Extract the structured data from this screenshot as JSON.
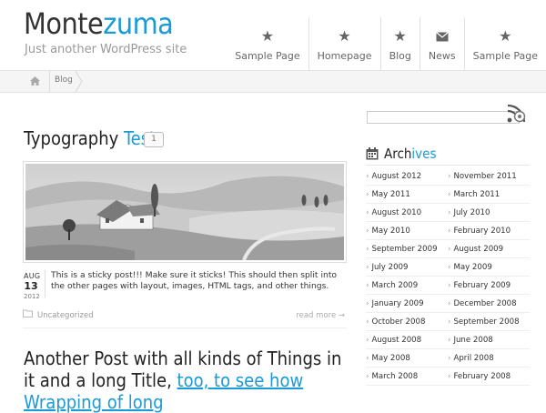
{
  "site": {
    "title_part1": "Monte",
    "title_part2": "zuma",
    "tagline": "Just another WordPress site"
  },
  "nav": {
    "items": [
      {
        "label": "Sample Page",
        "icon": "star-icon"
      },
      {
        "label": "Homepage",
        "icon": "star-icon",
        "active": true
      },
      {
        "label": "Blog",
        "icon": "star-icon"
      },
      {
        "label": "News",
        "icon": "envelope-icon"
      },
      {
        "label": "Sample Page",
        "icon": "star-icon"
      }
    ]
  },
  "breadcrumb": {
    "home_icon": "home-icon",
    "current": "Blog"
  },
  "post": {
    "title_part1": "Typography ",
    "title_part2": "Test",
    "comment_count": "1",
    "date_month": "AUG",
    "date_day": "13",
    "date_year": "2012",
    "excerpt": "This is a sticky post!!! Make sure it sticks! This should then split into the other pages with layout, images, HTML tags, and other things.",
    "category": "Uncategorized",
    "read_more": "read more →"
  },
  "post2": {
    "title_part1": "Another Post with all kinds of Things in it and a long Title, ",
    "title_part2": "too, to see how Wrapping of long"
  },
  "sidebar": {
    "search_placeholder": "",
    "archives_title_part1": "Arch",
    "archives_title_part2": "ives",
    "archives": [
      [
        "August 2012",
        "November 2011"
      ],
      [
        "May 2011",
        "March 2011"
      ],
      [
        "August 2010",
        "July 2010"
      ],
      [
        "May 2010",
        "February 2010"
      ],
      [
        "September 2009",
        "August 2009"
      ],
      [
        "July 2009",
        "May 2009"
      ],
      [
        "March 2009",
        "February 2009"
      ],
      [
        "January 2009",
        "December 2008"
      ],
      [
        "October 2008",
        "September 2008"
      ],
      [
        "August 2008",
        "June 2008"
      ],
      [
        "May 2008",
        "April 2008"
      ],
      [
        "March 2008",
        "February 2008"
      ]
    ]
  },
  "colors": {
    "accent": "#1a9ad6",
    "text": "#333333",
    "muted": "#999999"
  }
}
